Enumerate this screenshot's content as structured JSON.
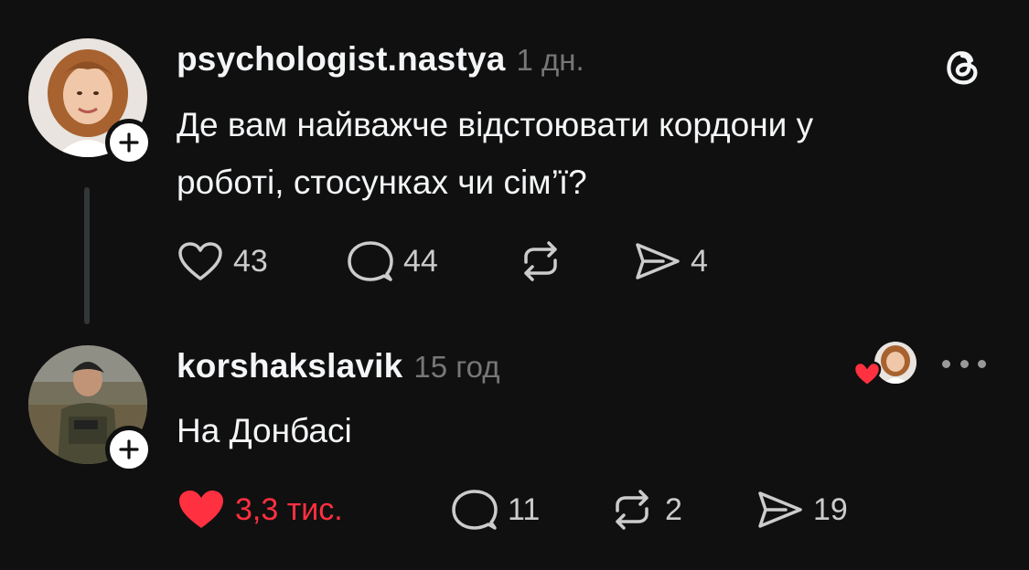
{
  "colors": {
    "background": "#101010",
    "text": "#f3f5f7",
    "muted": "#777777",
    "like_red": "#ff3040"
  },
  "posts": [
    {
      "username": "psychologist.nastya",
      "time": "1 дн.",
      "text_line1": "Де вам найважче відстоювати кордони у",
      "text_line2": "роботі, стосунках чи сім’ї?",
      "likes": "43",
      "replies": "44",
      "reposts": "",
      "shares": "4",
      "liked": false
    },
    {
      "username": "korshakslavik",
      "time": "15 год",
      "text_line1": "На Донбасі",
      "likes": "3,3 тис.",
      "replies": "11",
      "reposts": "2",
      "shares": "19",
      "liked": true
    }
  ],
  "icons": {
    "follow": "plus-icon",
    "like": "heart-icon",
    "reply": "speech-bubble-icon",
    "repost": "repost-icon",
    "share": "send-icon",
    "app": "threads-logo-icon",
    "more": "more-dots-icon"
  }
}
